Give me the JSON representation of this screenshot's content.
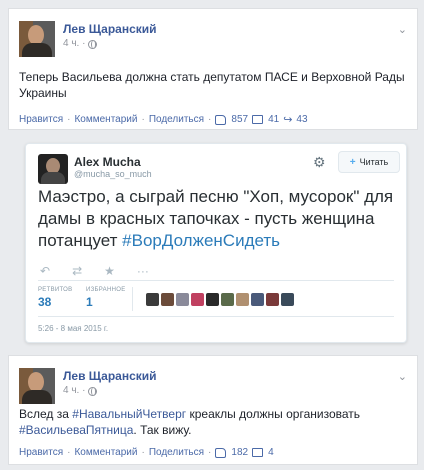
{
  "post1": {
    "author": "Лев Щаранский",
    "time": "4 ч. ·",
    "text": "Теперь Васильева должна стать депутатом ПАСЕ и Верховной Рады Украины",
    "actions": {
      "like": "Нравится",
      "comment": "Комментарий",
      "share": "Поделиться",
      "likes": "857",
      "comments": "41",
      "shares": "43"
    }
  },
  "tweet": {
    "name": "Alex Mucha",
    "handle": "@mucha_so_much",
    "follow_label": "Читать",
    "text": "Маэстро, а сыграй песню \"Хоп, мусорок\" для дамы в красных тапочках - пусть женщина потанцует ",
    "hashtag": "#ВорДолженСидеть",
    "retweets_label": "РЕТВИТОВ",
    "retweets": "38",
    "favorites_label": "ИЗБРАННОЕ",
    "favorites": "1",
    "date": "5:26 - 8 мая 2015 г.",
    "icons": [
      "reply-icon",
      "retweet-icon",
      "favorite-icon",
      "more-icon"
    ],
    "colors": {
      "link": "#2b7bb9",
      "follow_plus": "#55acee"
    }
  },
  "post2": {
    "author": "Лев Щаранский",
    "time": "4 ч. ·",
    "text_before": "Вслед за ",
    "hashtag1": "#НавальныйЧетверг",
    "text_middle": " креаклы должны организовать ",
    "hashtag2": "#ВасильеваПятница",
    "text_after": ". Так вижу.",
    "actions": {
      "like": "Нравится",
      "comment": "Комментарий",
      "share": "Поделиться",
      "likes": "182",
      "comments": "4"
    }
  },
  "colors": {
    "fb_link": "#3b5998",
    "fb_action": "#4b6aa8",
    "muted": "#90949c"
  }
}
